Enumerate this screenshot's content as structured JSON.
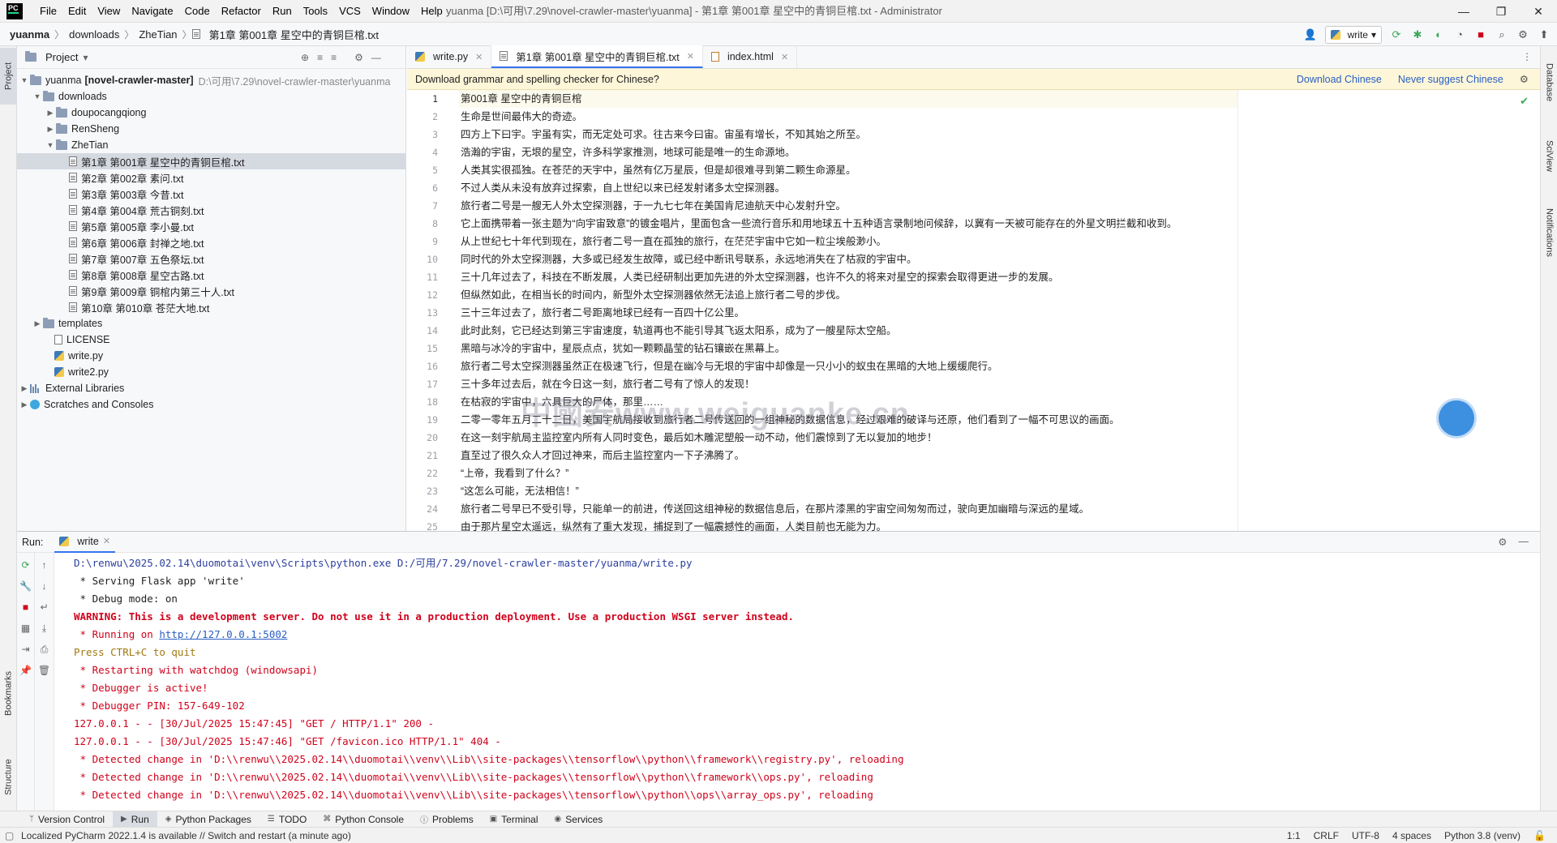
{
  "app": {
    "logo": "PC",
    "menu": [
      "File",
      "Edit",
      "View",
      "Navigate",
      "Code",
      "Refactor",
      "Run",
      "Tools",
      "VCS",
      "Window",
      "Help"
    ],
    "title": "yuanma [D:\\可用\\7.29\\novel-crawler-master\\yuanma] - 第1章 第001章 星空中的青铜巨棺.txt - Administrator"
  },
  "navbar": {
    "breadcrumbs": [
      "yuanma",
      "downloads",
      "ZheTian",
      "第1章 第001章 星空中的青铜巨棺.txt"
    ],
    "run_config": "write"
  },
  "left_stripe": {
    "project": "Project",
    "bookmarks": "Bookmarks",
    "structure": "Structure"
  },
  "right_stripe": {
    "database": "Database",
    "sciview": "SciView",
    "notifications": "Notifications"
  },
  "project": {
    "title": "Project",
    "root": {
      "name": "yuanma",
      "module": "[novel-crawler-master]",
      "path": "D:\\可用\\7.29\\novel-crawler-master\\yuanma"
    },
    "downloads": "downloads",
    "folders": [
      "doupocangqiong",
      "RenSheng",
      "ZheTian"
    ],
    "files": [
      "第1章 第001章 星空中的青铜巨棺.txt",
      "第2章 第002章 素问.txt",
      "第3章 第003章 今昔.txt",
      "第4章 第004章 荒古铜刻.txt",
      "第5章 第005章 李小曼.txt",
      "第6章 第006章 封禅之地.txt",
      "第7章 第007章 五色祭坛.txt",
      "第8章 第008章 星空古路.txt",
      "第9章 第009章 铜棺内第三十人.txt",
      "第10章 第010章 苍茫大地.txt"
    ],
    "templates": "templates",
    "license": "LICENSE",
    "write_py": "write.py",
    "write2_py": "write2.py",
    "external_libraries": "External Libraries",
    "scratches": "Scratches and Consoles"
  },
  "editor": {
    "tabs": [
      "write.py",
      "第1章 第001章 星空中的青铜巨棺.txt",
      "index.html"
    ],
    "banner": {
      "message": "Download grammar and spelling checker for Chinese?",
      "download": "Download Chinese",
      "never": "Never suggest Chinese"
    },
    "watermark": "中國安www.weiguanke.cn",
    "lines": [
      "第001章  星空中的青铜巨棺",
      "生命是世间最伟大的奇迹。",
      "四方上下曰宇。宇虽有实，而无定处可求。往古来今曰宙。宙虽有增长，不知其始之所至。",
      "浩瀚的宇宙，无垠的星空，许多科学家推测，地球可能是唯一的生命源地。",
      "人类其实很孤独。在苍茫的天宇中，虽然有亿万星辰，但是却很难寻到第二颗生命源星。",
      "不过人类从未没有放弃过探索，自上世纪以来已经发射诸多太空探测器。",
      "旅行者二号是一艘无人外太空探测器，于一九七七年在美国肯尼迪航天中心发射升空。",
      "它上面携带着一张主题为“向宇宙致意”的镀金唱片，里面包含一些流行音乐和用地球五十五种语言录制地问候辞，以冀有一天被可能存在的外星文明拦截和收到。",
      "从上世纪七十年代到现在，旅行者二号一直在孤独的旅行，在茫茫宇宙中它如一粒尘埃般渺小。",
      "同时代的外太空探测器，大多或已经发生故障，或已经中断讯号联系，永远地消失在了枯寂的宇宙中。",
      "三十几年过去了，科技在不断发展，人类已经研制出更加先进的外太空探测器，也许不久的将来对星空的探索会取得更进一步的发展。",
      "但纵然如此，在相当长的时间内，新型外太空探测器依然无法追上旅行者二号的步伐。",
      "三十三年过去了，旅行者二号距离地球已经有一百四十亿公里。",
      "此时此刻，它已经达到第三宇宙速度，轨道再也不能引导其飞返太阳系，成为了一艘星际太空船。",
      "黑暗与冰冷的宇宙中，星辰点点，犹如一颗颗晶莹的钻石镶嵌在黑幕上。",
      "旅行者二号太空探测器虽然正在极速飞行，但是在幽冷与无垠的宇宙中却像是一只小小的蚁虫在黑暗的大地上缓缓爬行。",
      "三十多年过去后，就在今日这一刻，旅行者二号有了惊人的发现！",
      "在枯寂的宇宙中，六具巨大的尸体，那里……",
      "二零一零年五月二十二日，美国宇航局接收到旅行者二号传送回的一组神秘的数据信息，经过艰难的破译与还原，他们看到了一幅不可思议的画面。",
      "在这一刻宇航局主监控室内所有人同时变色，最后如木雕泥塑般一动不动，他们震惊到了无以复加的地步！",
      "直至过了很久众人才回过神来，而后主监控室内一下子沸腾了。",
      "“上帝，我看到了什么？”",
      "“这怎么可能，无法相信！”",
      "旅行者二号早已不受引导，只能单一的前进，传送回这组神秘的数据信息后，在那片漆黑的宇宙空间匆匆而过，驶向更加幽暗与深远的星域。",
      "由于那片星空太遥远，纵然有了重大发现，捕捉到了一幅震撼性的画面，人类目前也无能为力。"
    ]
  },
  "run": {
    "label": "Run:",
    "tab": "write",
    "console": [
      {
        "cls": "c-blue",
        "text": "D:\\renwu\\2025.02.14\\duomotai\\venv\\Scripts\\python.exe D:/可用/7.29/novel-crawler-master/yuanma/write.py"
      },
      {
        "cls": "c-dark",
        "text": " * Serving Flask app 'write'"
      },
      {
        "cls": "c-dark",
        "text": " * Debug mode: on"
      },
      {
        "cls": "c-redb",
        "text": "WARNING: This is a development server. Do not use it in a production deployment. Use a production WSGI server instead."
      },
      {
        "cls": "c-red",
        "text": " * Running on ",
        "link": "http://127.0.0.1:5002"
      },
      {
        "cls": "c-olive",
        "text": "Press CTRL+C to quit"
      },
      {
        "cls": "c-red",
        "text": " * Restarting with watchdog (windowsapi)"
      },
      {
        "cls": "c-red",
        "text": " * Debugger is active!"
      },
      {
        "cls": "c-red",
        "text": " * Debugger PIN: 157-649-102"
      },
      {
        "cls": "c-red",
        "text": "127.0.0.1 - - [30/Jul/2025 15:47:45] \"GET / HTTP/1.1\" 200 -"
      },
      {
        "cls": "c-red",
        "text": "127.0.0.1 - - [30/Jul/2025 15:47:46] \"GET /favicon.ico HTTP/1.1\" 404 -"
      },
      {
        "cls": "c-red",
        "text": " * Detected change in 'D:\\\\renwu\\\\2025.02.14\\\\duomotai\\\\venv\\\\Lib\\\\site-packages\\\\tensorflow\\\\python\\\\framework\\\\registry.py', reloading"
      },
      {
        "cls": "c-red",
        "text": " * Detected change in 'D:\\\\renwu\\\\2025.02.14\\\\duomotai\\\\venv\\\\Lib\\\\site-packages\\\\tensorflow\\\\python\\\\framework\\\\ops.py', reloading"
      },
      {
        "cls": "c-red",
        "text": " * Detected change in 'D:\\\\renwu\\\\2025.02.14\\\\duomotai\\\\venv\\\\Lib\\\\site-packages\\\\tensorflow\\\\python\\\\ops\\\\array_ops.py', reloading"
      }
    ]
  },
  "tool_tabs": [
    "Version Control",
    "Run",
    "Python Packages",
    "TODO",
    "Python Console",
    "Problems",
    "Terminal",
    "Services"
  ],
  "status": {
    "message": "Localized PyCharm 2022.1.4 is available // Switch and restart (a minute ago)",
    "position": "1:1",
    "line_sep": "CRLF",
    "encoding": "UTF-8",
    "indent": "4 spaces",
    "interpreter": "Python 3.8 (venv)"
  },
  "colors": {
    "accent": "#3574f0",
    "selection": "#d5d9e0",
    "banner": "#fdf6d9",
    "error": "#d0021b"
  }
}
